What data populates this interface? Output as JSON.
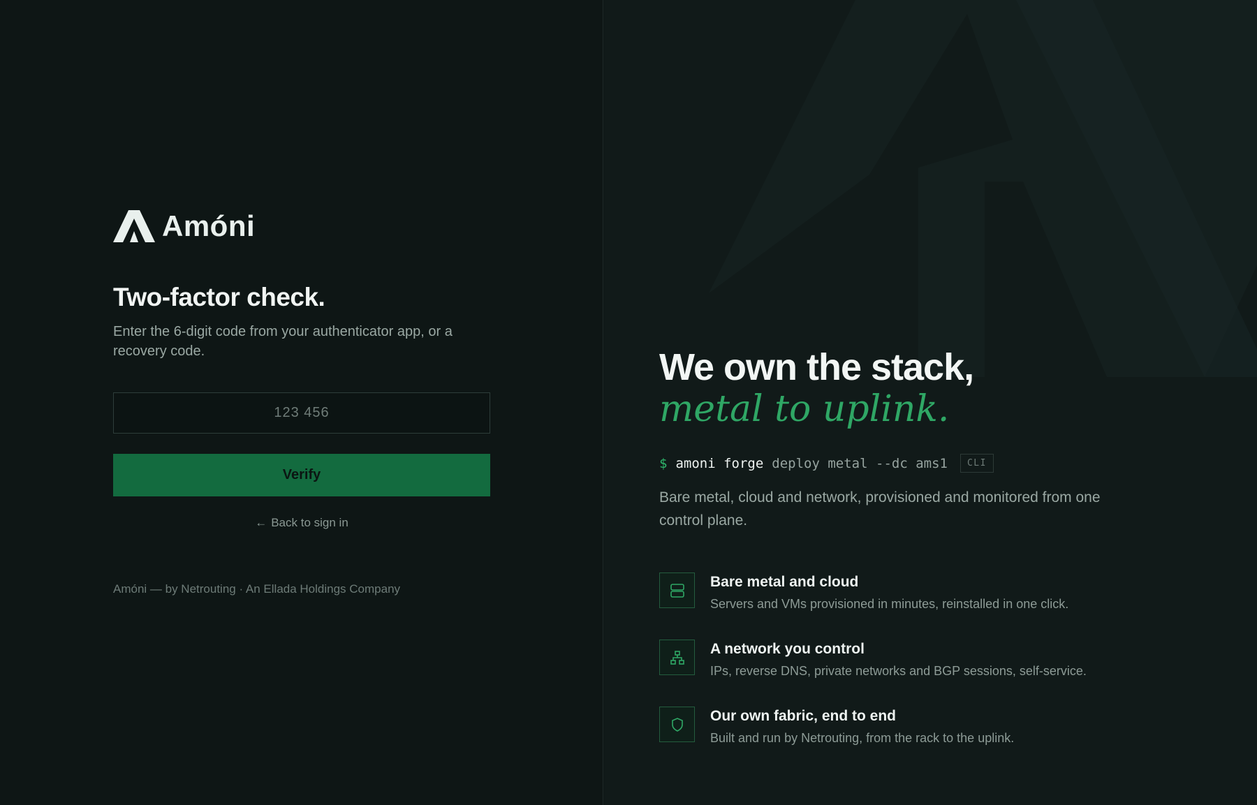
{
  "brand": {
    "name": "Amóni"
  },
  "auth": {
    "title": "Two-factor check.",
    "subtitle": "Enter the 6-digit code from your authenticator app, or a recovery code.",
    "code_placeholder": "123 456",
    "code_value": "",
    "verify_label": "Verify",
    "back_arrow": "←",
    "back_label": "Back to sign in"
  },
  "footer": {
    "text": "Amóni — by Netrouting · An Ellada Holdings Company"
  },
  "hero": {
    "headline": "We own the stack,",
    "headline_accent": "metal to uplink.",
    "cli": {
      "prompt": "$",
      "command": "amoni forge",
      "args": "deploy metal --dc ams1",
      "badge": "CLI"
    },
    "description": "Bare metal, cloud and network, provisioned and monitored from one control plane.",
    "features": [
      {
        "icon": "server-icon",
        "title": "Bare metal and cloud",
        "desc": "Servers and VMs provisioned in minutes, reinstalled in one click."
      },
      {
        "icon": "network-icon",
        "title": "A network you control",
        "desc": "IPs, reverse DNS, private networks and BGP sessions, self-service."
      },
      {
        "icon": "shield-icon",
        "title": "Our own fabric, end to end",
        "desc": "Built and run by Netrouting, from the rack to the uplink."
      }
    ]
  },
  "colors": {
    "accent": "#2fa765",
    "button": "#136b3f",
    "background": "#0e1615"
  }
}
